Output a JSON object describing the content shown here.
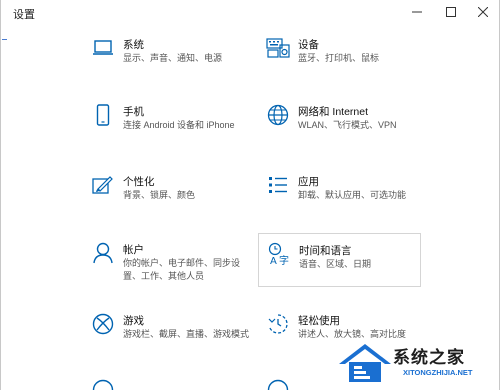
{
  "window": {
    "title": "设置"
  },
  "tiles": [
    {
      "id": "system",
      "title": "系统",
      "desc": [
        "显示、声音、通知、电源"
      ],
      "icon": "laptop-icon"
    },
    {
      "id": "devices",
      "title": "设备",
      "desc": [
        "蓝牙、打印机、鼠标"
      ],
      "icon": "keyboard-speaker-icon"
    },
    {
      "id": "phone",
      "title": "手机",
      "desc": [
        "连接 Android 设备和 iPhone"
      ],
      "icon": "phone-icon"
    },
    {
      "id": "network",
      "title": "网络和 Internet",
      "desc": [
        "WLAN、飞行模式、VPN"
      ],
      "icon": "globe-icon"
    },
    {
      "id": "personalization",
      "title": "个性化",
      "desc": [
        "背景、锁屏、颜色"
      ],
      "icon": "paint-brush-icon"
    },
    {
      "id": "apps",
      "title": "应用",
      "desc": [
        "卸载、默认应用、可选功能"
      ],
      "icon": "app-list-icon"
    },
    {
      "id": "accounts",
      "title": "帐户",
      "desc": [
        "你的帐户、电子邮件、同步设",
        "置、工作、其他人员"
      ],
      "icon": "person-icon"
    },
    {
      "id": "time-language",
      "title": "时间和语言",
      "desc": [
        "语音、区域、日期"
      ],
      "icon": "time-language-icon"
    },
    {
      "id": "gaming",
      "title": "游戏",
      "desc": [
        "游戏栏、截屏、直播、游戏模式"
      ],
      "icon": "xbox-icon"
    },
    {
      "id": "ease-of-access",
      "title": "轻松使用",
      "desc": [
        "讲述人、放大镜、高对比度"
      ],
      "icon": "ease-of-access-icon"
    }
  ],
  "watermark": {
    "text": "系统之家",
    "url": "XITONGZHIJIA.NET"
  },
  "colors": {
    "accent": "#0063b1",
    "watermark_blue": "#1a6fd1"
  }
}
